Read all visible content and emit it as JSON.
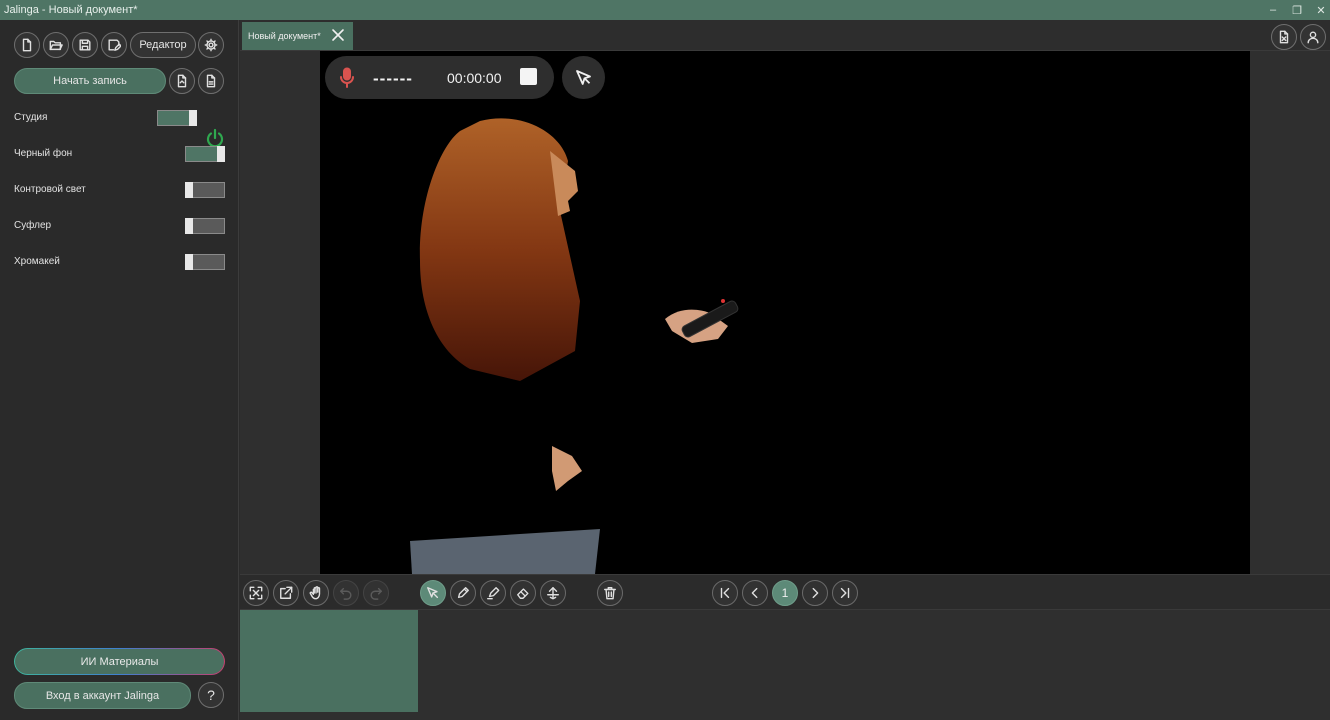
{
  "window": {
    "title": "Jalinga - Новый документ*",
    "controls": [
      "minimize-icon",
      "restore-icon",
      "close-icon"
    ]
  },
  "sidebar": {
    "file_icons": [
      "new-file-icon",
      "open-folder-icon",
      "save-icon",
      "save-as-icon"
    ],
    "editor_label": "Редактор",
    "settings_icon": "gear-icon",
    "record_label": "Начать запись",
    "record_extra_icons": [
      "export-doc-icon",
      "document-icon"
    ],
    "options": [
      {
        "label": "Студия",
        "on": true
      },
      {
        "label": "Черный фон",
        "on": true
      },
      {
        "label": "Контровой свет",
        "on": false
      },
      {
        "label": "Суфлер",
        "on": false
      },
      {
        "label": "Хромакей",
        "on": false
      }
    ],
    "ai_materials_label": "ИИ Материалы",
    "login_label": "Вход в аккаунт Jalinga",
    "help_label": "?"
  },
  "tabs": [
    {
      "label": "Новый документ*",
      "active": true
    }
  ],
  "recorder": {
    "level_text": "------",
    "time": "00:00:00",
    "mic_color": "#d9534f"
  },
  "toolbar": {
    "pager_current": "1"
  },
  "colors": {
    "accent": "#4f7565",
    "accent_light": "#5d8a78",
    "power_green": "#2fa84f"
  }
}
